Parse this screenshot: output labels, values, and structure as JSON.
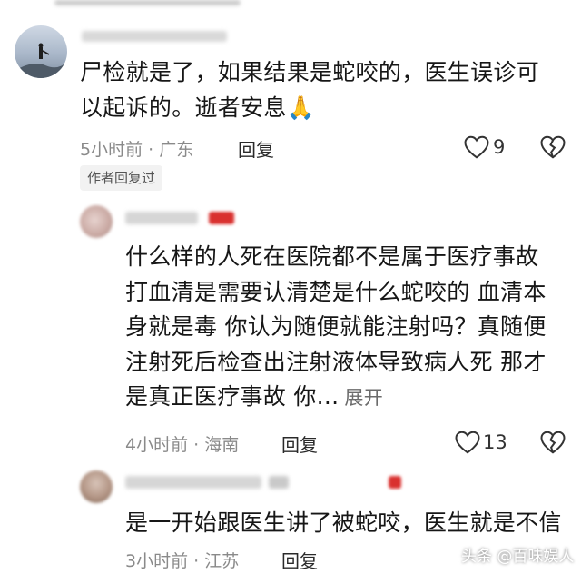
{
  "comments": [
    {
      "text_line1": "尸检就是了，如果结果是蛇咬的，医生误诊可",
      "text_line2": "以起诉的。逝者安息🙏",
      "time": "5小时前",
      "location": "广东",
      "reply_label": "回复",
      "likes": "9",
      "author_badge": "作者回复过"
    },
    {
      "lines": [
        "什么样的人死在医院都不是属于医疗事故",
        "打血清是需要认清楚是什么蛇咬的  血清本",
        "身就是毒  你认为随便就能注射吗？真随便",
        "注射死后检查出注射液体导致病人死 那才",
        "是真正医疗事故  你..."
      ],
      "expand_label": "展开",
      "time": "4小时前",
      "location": "海南",
      "reply_label": "回复",
      "likes": "13"
    },
    {
      "text": "是一开始跟医生讲了被蛇咬，医生就是不信",
      "time": "3小时前",
      "location": "江苏",
      "reply_label": "回复"
    }
  ],
  "watermark": "头条 @百味娱人",
  "colors": {
    "text": "#161616",
    "meta": "#8a8a8a",
    "badge_bg": "#f2f2f2",
    "badge_red": "#d9312f"
  },
  "icons": [
    "heart-icon",
    "broken-heart-icon"
  ]
}
